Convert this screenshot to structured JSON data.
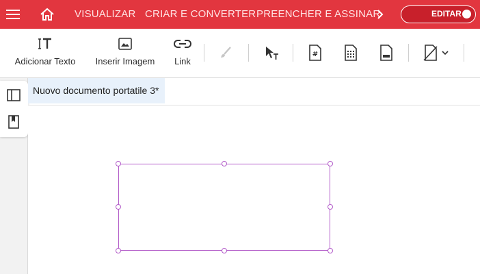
{
  "topbar": {
    "bg_color": "#e2363f",
    "menu_icon": "hamburger-menu-icon",
    "home_icon": "home-icon",
    "nav": [
      "VISUALIZAR",
      "CRIAR E CONVERTER",
      "PREENCHER E ASSINAR"
    ],
    "more_icon": "chevron-right-icon",
    "edit_toggle_label": "EDITAR"
  },
  "toolbar": {
    "add_text_label": "Adicionar Texto",
    "insert_image_label": "Inserir Imagem",
    "link_label": "Link",
    "icons": [
      "add-text-icon",
      "insert-image-icon",
      "link-icon",
      "brush-icon",
      "select-text-cursor-icon",
      "page-number-icon",
      "bates-numbering-icon",
      "header-footer-icon",
      "watermark-icon"
    ]
  },
  "sidebar": {
    "icons": [
      "panel-toggle-icon",
      "bookmark-icon"
    ]
  },
  "document": {
    "tab_title": "Nuovo documento portatile 3*",
    "selection_color": "#b35cc9"
  }
}
